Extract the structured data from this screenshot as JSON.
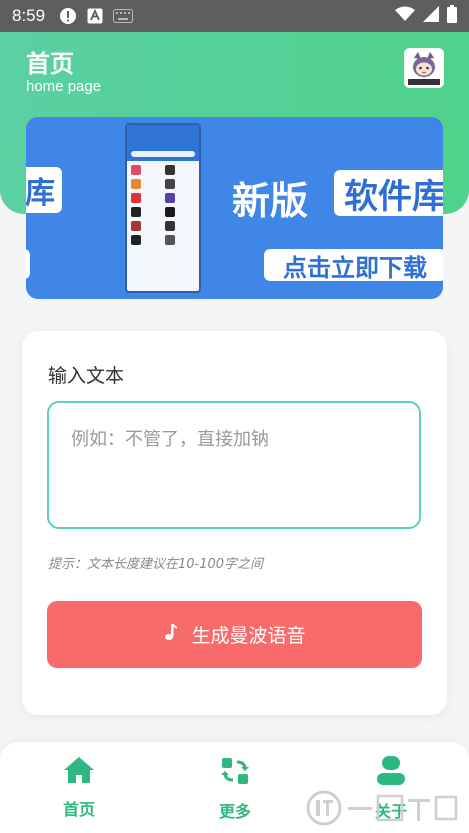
{
  "status_bar": {
    "time": "8:59"
  },
  "header": {
    "title": "首页",
    "subtitle": "home page"
  },
  "banner": {
    "chip_left": "库",
    "title_white": "新版",
    "chip_right": "软件库",
    "download_text": "点击立即下载"
  },
  "card": {
    "label": "输入文本",
    "input_placeholder": "例如：不管了，直接加钠",
    "input_value": "",
    "hint": "提示：文本长度建议在10-100字之间",
    "button_label": "生成曼波语音"
  },
  "nav": {
    "items": [
      {
        "label": "首页",
        "icon": "home-icon"
      },
      {
        "label": "更多",
        "icon": "refresh-icon"
      },
      {
        "label": "关于",
        "icon": "user-icon"
      }
    ]
  },
  "colors": {
    "header_green": "#4fd28a",
    "banner_blue": "#3f86e6",
    "button_red": "#f76b6b",
    "accent_green": "#2eb87f",
    "input_border": "#5ccfbe"
  }
}
